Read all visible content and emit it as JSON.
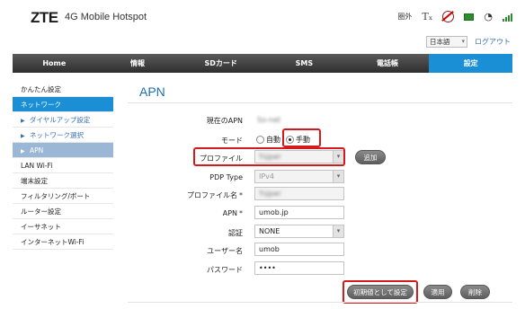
{
  "header": {
    "logo": "ZTE",
    "product": "4G Mobile Hotspot",
    "status_text": "圏外",
    "icons": [
      "sim-icon",
      "no-network-icon",
      "battery-icon",
      "wifi-icon",
      "signal-icon"
    ],
    "language": "日本語",
    "logout": "ログアウト"
  },
  "nav": {
    "items": [
      "Home",
      "情報",
      "SDカード",
      "SMS",
      "電話帳",
      "設定"
    ],
    "active": "設定"
  },
  "sidebar": {
    "items": [
      {
        "label": "かんたん設定"
      },
      {
        "label": "ネットワーク"
      },
      {
        "label": "ダイヤルアップ設定"
      },
      {
        "label": "ネットワーク選択"
      },
      {
        "label": "APN"
      },
      {
        "label": "LAN Wi-Fi"
      },
      {
        "label": "端末設定"
      },
      {
        "label": "フィルタリング/ポート"
      },
      {
        "label": "ルーター設定"
      },
      {
        "label": "イーサネット"
      },
      {
        "label": "インターネットWi-Fi"
      }
    ]
  },
  "main": {
    "title": "APN",
    "current_apn_label": "現在のAPN",
    "current_apn_value": "So-net",
    "mode_label": "モード",
    "mode_auto": "自動",
    "mode_manual": "手動",
    "profile_label": "プロファイル",
    "profile_value": "Ysjper",
    "add_button": "追加",
    "pdp_type_label": "PDP Type",
    "pdp_type_value": "IPv4",
    "profile_name_label": "プロファイル名",
    "profile_name_value": "Ysjper",
    "apn_label": "APN",
    "apn_value": "umob.jp",
    "auth_label": "認証",
    "auth_value": "NONE",
    "username_label": "ユーザー名",
    "username_value": "umob",
    "password_label": "パスワード",
    "password_value": "••••",
    "required_mark": "*",
    "default_button": "初期値として設定",
    "apply_button": "適用",
    "delete_button": "削除"
  },
  "colors": {
    "accent": "#1a8fd6",
    "highlight": "#d41a1a",
    "nav_bg": "#3a3a3a"
  }
}
